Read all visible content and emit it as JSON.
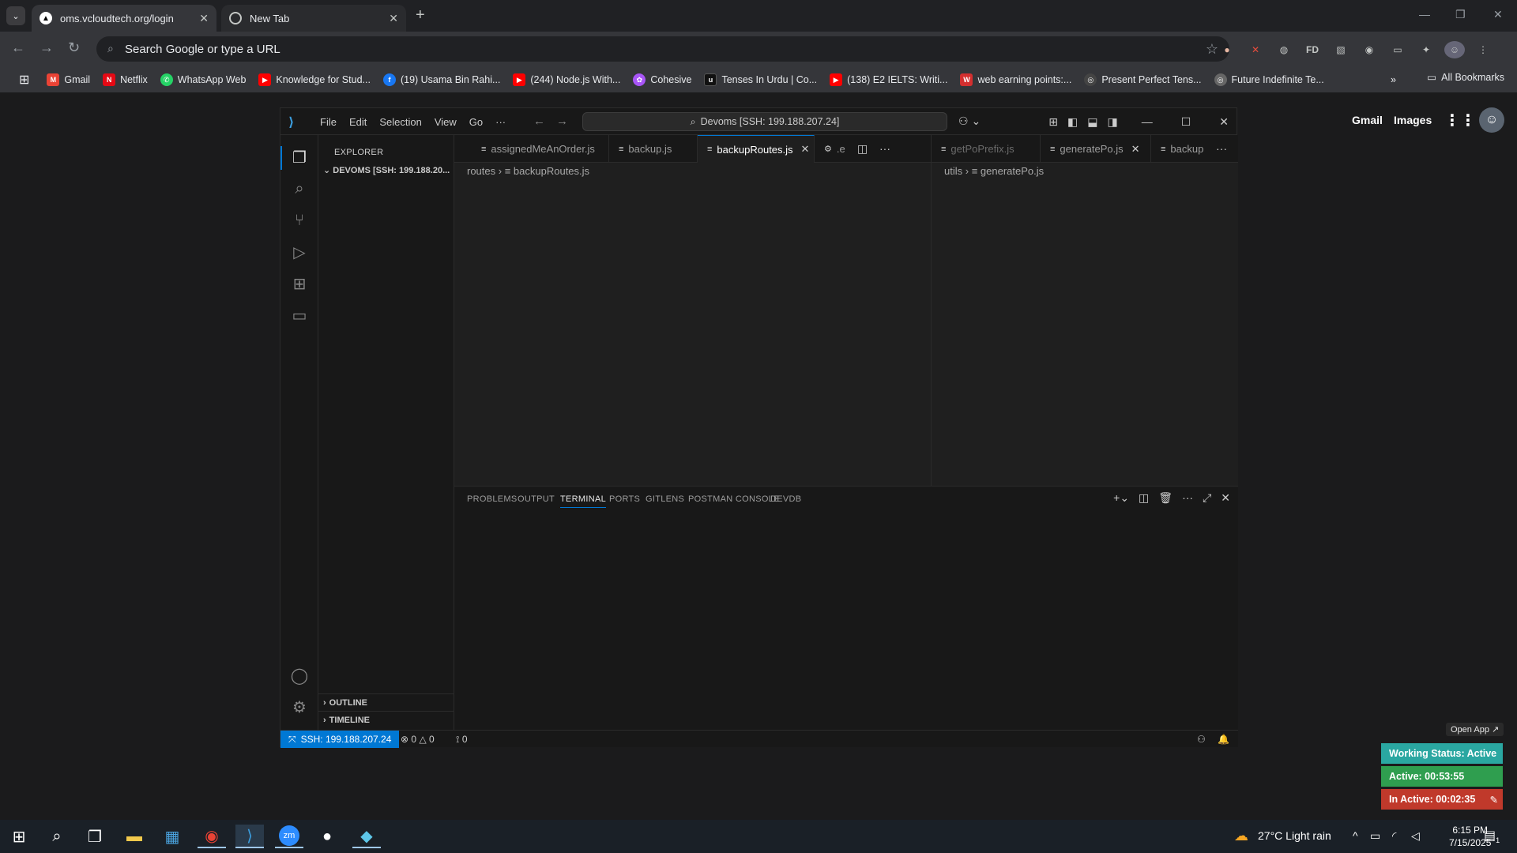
{
  "chrome": {
    "tabs": [
      {
        "title": "oms.vcloudtech.org/login",
        "favicon": "A"
      },
      {
        "title": "New Tab",
        "favicon": "chrome"
      }
    ],
    "omnibox_placeholder": "Search Google or type a URL",
    "bookmarks": [
      {
        "label": "Gmail",
        "color": "#ea4335",
        "glyph": "M"
      },
      {
        "label": "Netflix",
        "color": "#e50914",
        "glyph": "N"
      },
      {
        "label": "WhatsApp Web",
        "color": "#25d366",
        "glyph": "✆"
      },
      {
        "label": "Knowledge for Stud...",
        "color": "#ff0000",
        "glyph": "▶"
      },
      {
        "label": "(19) Usama Bin Rahi...",
        "color": "#1877f2",
        "glyph": "f"
      },
      {
        "label": "(244) Node.js With...",
        "color": "#ff0000",
        "glyph": "▶"
      },
      {
        "label": "Cohesive",
        "color": "#a855f7",
        "glyph": "✿"
      },
      {
        "label": "Tenses In Urdu | Co...",
        "color": "#111111",
        "glyph": "u"
      },
      {
        "label": "(138) E2 IELTS: Writi...",
        "color": "#ff0000",
        "glyph": "▶"
      },
      {
        "label": "web earning points:...",
        "color": "#d32f2f",
        "glyph": "W"
      },
      {
        "label": "Present Perfect Tens...",
        "color": "#444444",
        "glyph": "◎"
      },
      {
        "label": "Future Indefinite Te...",
        "color": "#666666",
        "glyph": "◎"
      }
    ],
    "all_bookmarks": "All Bookmarks"
  },
  "google": {
    "gmail": "Gmail",
    "images": "Images"
  },
  "vscode": {
    "menu": [
      "File",
      "Edit",
      "Selection",
      "View",
      "Go",
      "···"
    ],
    "command_center": "Devoms [SSH: 199.188.207.24]",
    "sidebar": {
      "title": "EXPLORER",
      "folder": "DEVOMS [SSH: 199.188.20...",
      "outline": "OUTLINE",
      "timeline": "TIMELINE"
    },
    "tabs_left": [
      {
        "label": "assignedMeAnOrder.js"
      },
      {
        "label": "backup.js"
      },
      {
        "label": "backupRoutes.js"
      },
      {
        "label": ".e"
      }
    ],
    "tabs_right": [
      {
        "label": "getPoPrefix.js"
      },
      {
        "label": "generatePo.js"
      },
      {
        "label": "backup"
      }
    ],
    "breadcrumb_left": {
      "folder": "routes",
      "file": "backupRoutes.js"
    },
    "breadcrumb_right": {
      "folder": "utils",
      "file": "generatePo.js"
    },
    "panel_tabs": [
      "PROBLEMS",
      "OUTPUT",
      "TERMINAL",
      "PORTS",
      "GITLENS",
      "POSTMAN CONSOLE",
      "DEVDB"
    ],
    "status": {
      "remote": "SSH: 199.188.207.24",
      "errors": "0",
      "warnings": "0",
      "ports": "0"
    }
  },
  "widget": {
    "open_app": "Open App ↗",
    "working_status": "Working Status: Active",
    "active": "Active: 00:53:55",
    "inactive": "In Active: 00:02:35",
    "colors": {
      "working": "#2aa7a1",
      "active": "#2f9e4f",
      "inactive": "#c0392b"
    }
  },
  "taskbar": {
    "weather": "27°C  Light rain",
    "time": "6:15 PM",
    "date": "7/15/2025",
    "notifications": "1"
  }
}
